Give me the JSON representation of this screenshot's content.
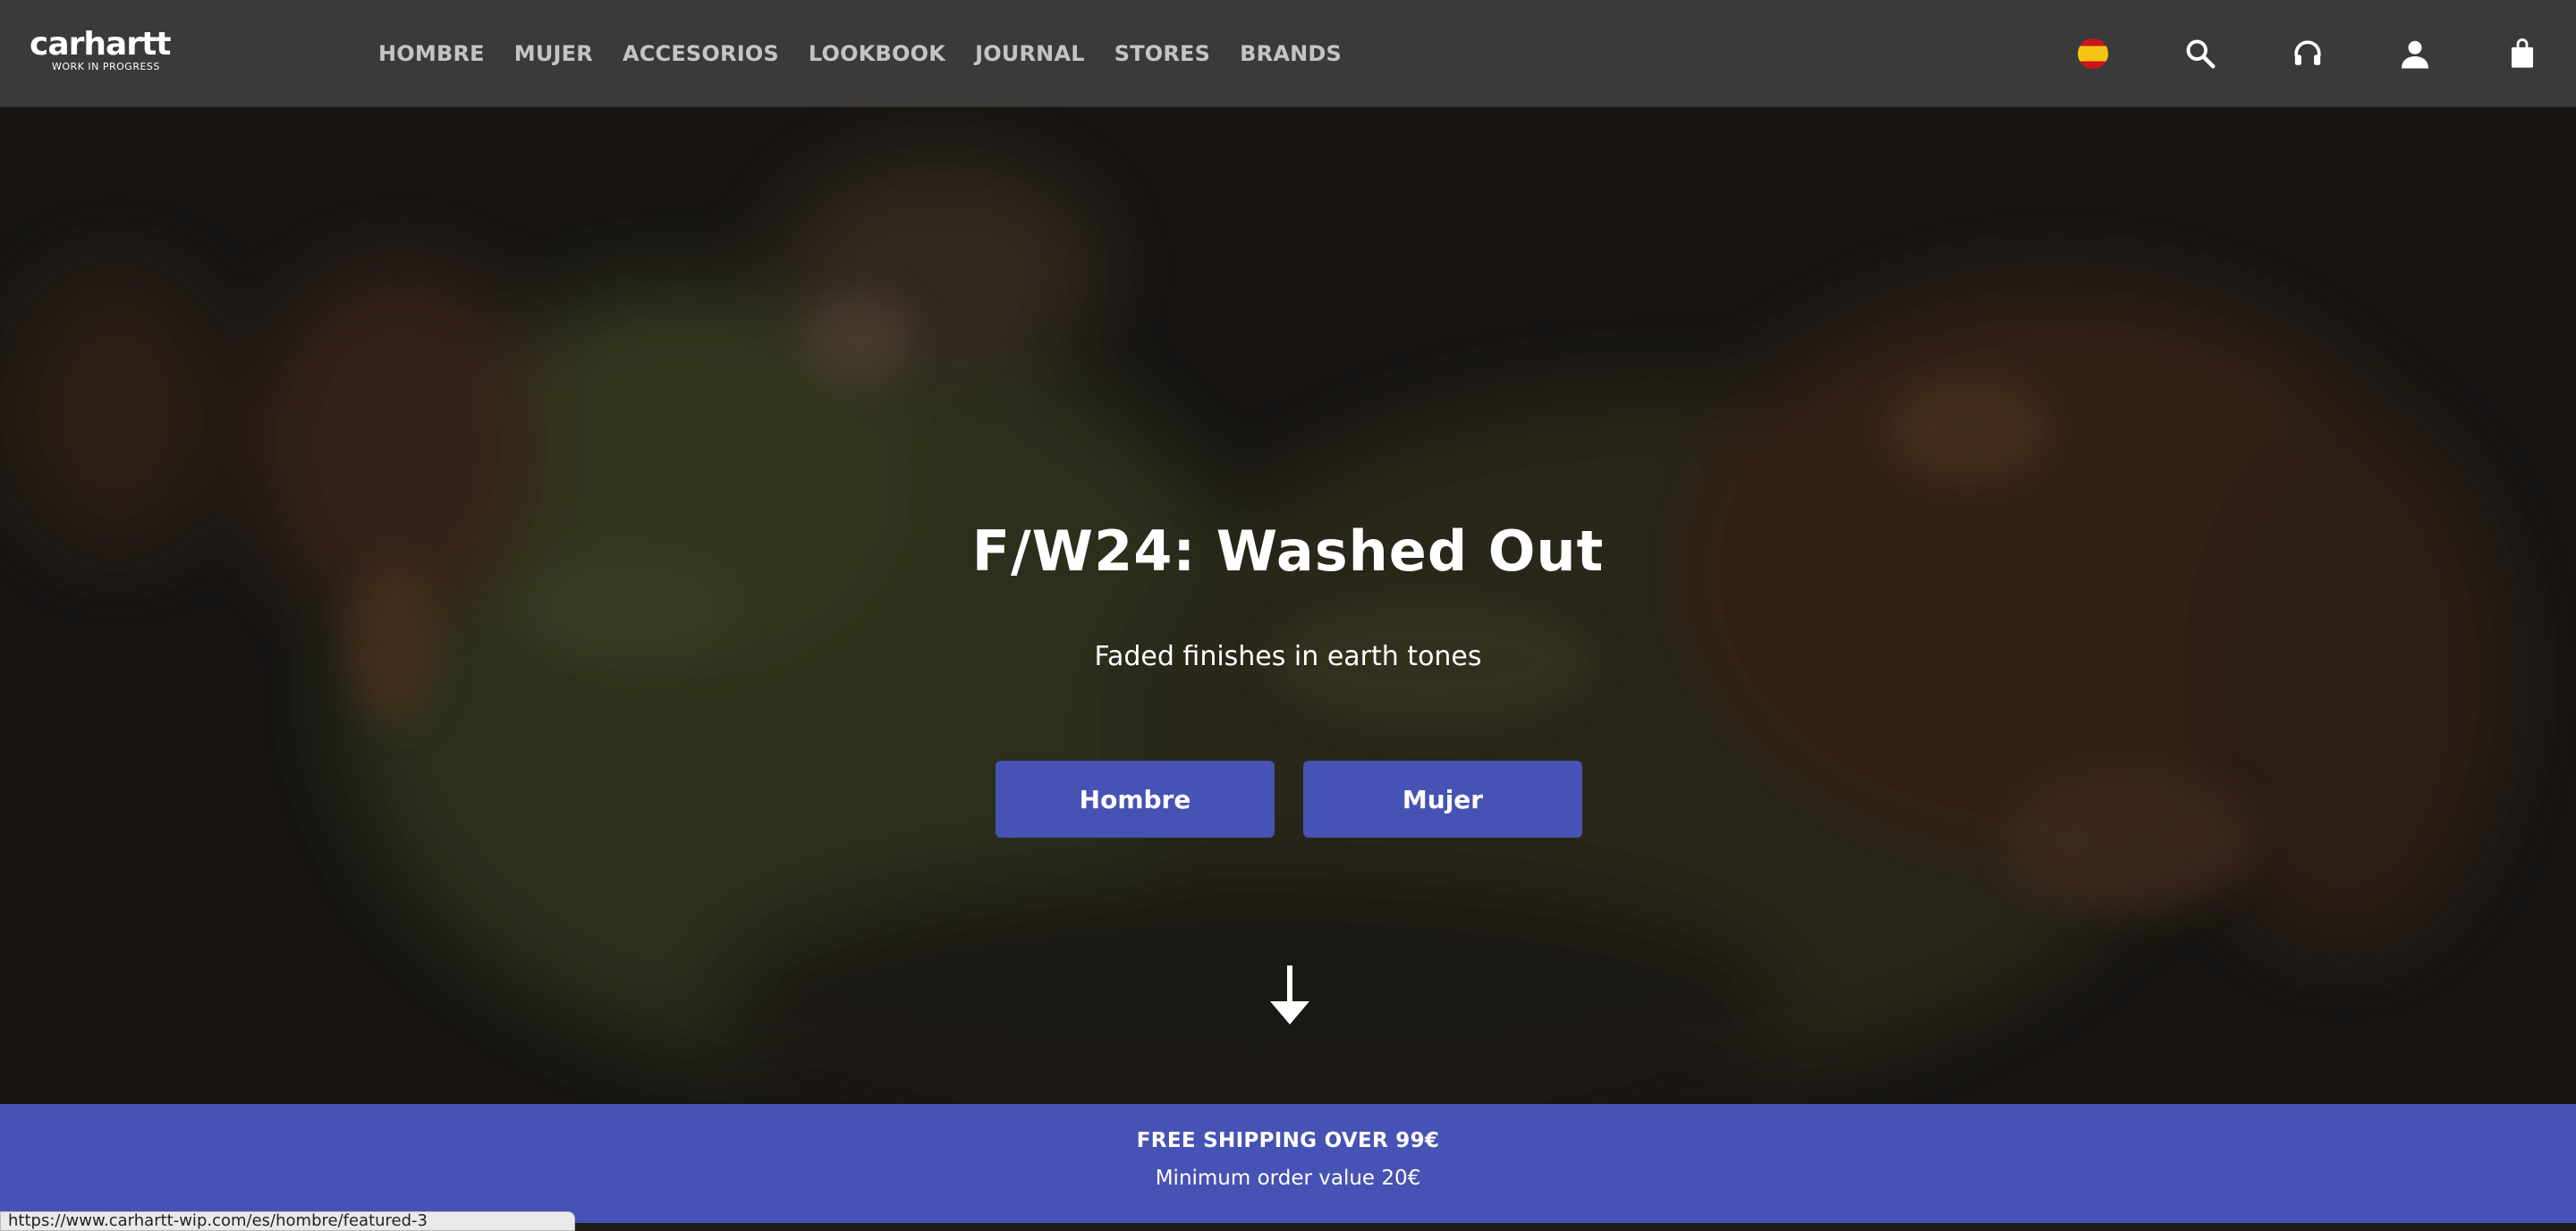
{
  "header": {
    "logo_text": "carhartt",
    "logo_tagline": "WORK IN PROGRESS",
    "nav": [
      "HOMBRE",
      "MUJER",
      "ACCESORIOS",
      "LOOKBOOK",
      "JOURNAL",
      "STORES",
      "BRANDS"
    ],
    "icons": [
      "spain-flag-icon",
      "search-icon",
      "headphones-icon",
      "user-icon",
      "shopping-bag-icon"
    ]
  },
  "hero": {
    "title": "F/W24: Washed Out",
    "subtitle": "Faded finishes in earth tones",
    "buttons": [
      "Hombre",
      "Mujer"
    ]
  },
  "banner": {
    "line1": "FREE SHIPPING OVER 99€",
    "line2": "Minimum order value 20€"
  },
  "status_bar": {
    "url": "https://www.carhartt-wip.com/es/hombre/featured-3"
  },
  "colors": {
    "header_bg": "#3a3a3a",
    "accent": "#4653b4",
    "nav_text": "#c4c4c4"
  }
}
